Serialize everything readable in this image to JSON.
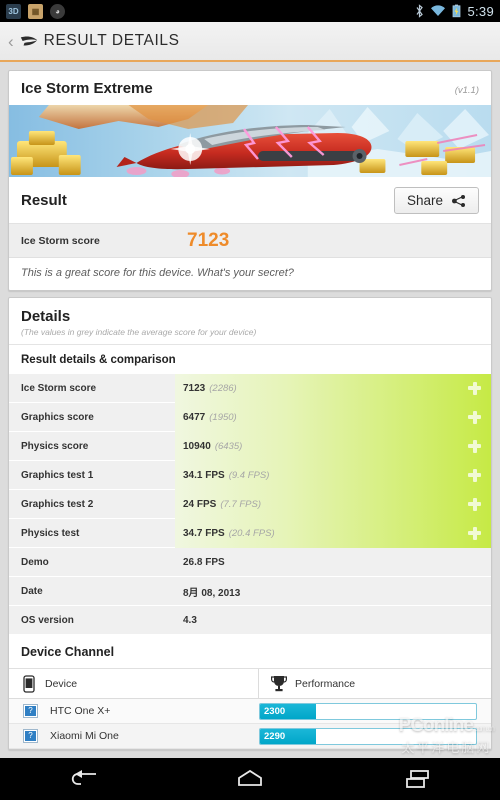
{
  "statusbar": {
    "time": "5:39",
    "left_icons": [
      {
        "name": "app-3dmark-icon",
        "glyph": "3D"
      },
      {
        "name": "app-file-icon",
        "glyph": "▦"
      },
      {
        "name": "app-cyanogen-icon",
        "glyph": "◕"
      }
    ],
    "right_icons": [
      "bluetooth-icon",
      "wifi-icon",
      "battery-charging-icon"
    ]
  },
  "titlebar": {
    "back_label": "‹",
    "title": "RESULT DETAILS"
  },
  "benchmark": {
    "name": "Ice Storm Extreme",
    "version": "(v1.1)",
    "banner_alt": "ice-storm-extreme-banner"
  },
  "result": {
    "heading": "Result",
    "share_label": "Share",
    "score_label": "Ice Storm score",
    "score_value": "7123",
    "score_color": "#ee8b2a",
    "message": "This is a great score for this device. What's your secret?"
  },
  "details": {
    "heading": "Details",
    "subtitle": "(The values in grey indicate the average score for your device)",
    "section_title": "Result details & comparison",
    "rows": [
      {
        "label": "Ice Storm score",
        "value": "7123",
        "avg": "(2286)",
        "bar": true
      },
      {
        "label": "Graphics score",
        "value": "6477",
        "avg": "(1950)",
        "bar": true
      },
      {
        "label": "Physics score",
        "value": "10940",
        "avg": "(6435)",
        "bar": true
      },
      {
        "label": "Graphics test 1",
        "value": "34.1 FPS",
        "avg": "(9.4 FPS)",
        "bar": true
      },
      {
        "label": "Graphics test 2",
        "value": "24 FPS",
        "avg": "(7.7 FPS)",
        "bar": true
      },
      {
        "label": "Physics test",
        "value": "34.7 FPS",
        "avg": "(20.4 FPS)",
        "bar": true
      },
      {
        "label": "Demo",
        "value": "26.8 FPS",
        "avg": "",
        "bar": false
      },
      {
        "label": "Date",
        "value": "8月 08, 2013",
        "avg": "",
        "bar": false
      },
      {
        "label": "OS version",
        "value": "4.3",
        "avg": "",
        "bar": false
      }
    ]
  },
  "device_channel": {
    "title": "Device Channel",
    "col_device": "Device",
    "col_performance": "Performance",
    "bar_color": "#00a6c9",
    "rows": [
      {
        "name": "HTC One X+",
        "score": "2300",
        "pct": 26
      },
      {
        "name": "Xiaomi Mi One",
        "score": "2290",
        "pct": 26
      }
    ]
  },
  "watermark": {
    "brand": "PConline",
    "suffix": ".com.cn",
    "chinese": "太平洋电脑网"
  },
  "navbar": {
    "items": [
      "back-nav-icon",
      "home-nav-icon",
      "recents-nav-icon"
    ]
  }
}
